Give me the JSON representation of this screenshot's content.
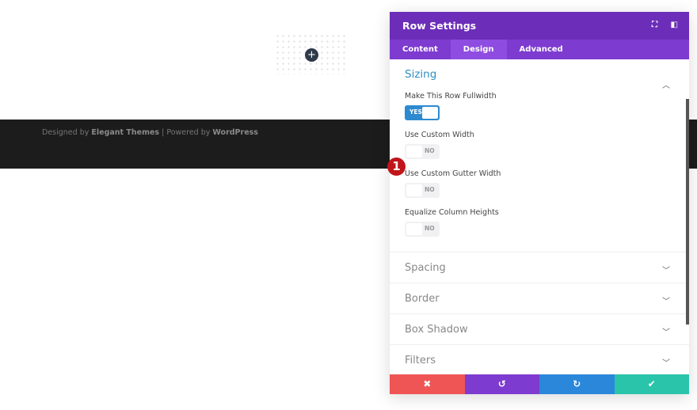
{
  "canvas": {
    "add_icon": "+"
  },
  "footer": {
    "prefix": "Designed by ",
    "brand": "Elegant Themes",
    "mid": " | Powered by ",
    "platform": "WordPress"
  },
  "panel": {
    "title": "Row Settings",
    "tabs": [
      "Content",
      "Design",
      "Advanced"
    ],
    "active_tab": "Design",
    "sizing": {
      "title": "Sizing",
      "fields": [
        {
          "label": "Make This Row Fullwidth",
          "value": "YES"
        },
        {
          "label": "Use Custom Width",
          "value": "NO"
        },
        {
          "label": "Use Custom Gutter Width",
          "value": "NO"
        },
        {
          "label": "Equalize Column Heights",
          "value": "NO"
        }
      ],
      "annotation": "1"
    },
    "groups": [
      "Spacing",
      "Border",
      "Box Shadow",
      "Filters"
    ],
    "actions": {
      "cancel": "✖",
      "undo": "↺",
      "redo": "↻",
      "save": "✔"
    },
    "colors": {
      "header": "#6c2eb9",
      "cancel": "#ef5555",
      "undo": "#7e3bd0",
      "redo": "#2b87da",
      "save": "#29c4a9"
    }
  }
}
